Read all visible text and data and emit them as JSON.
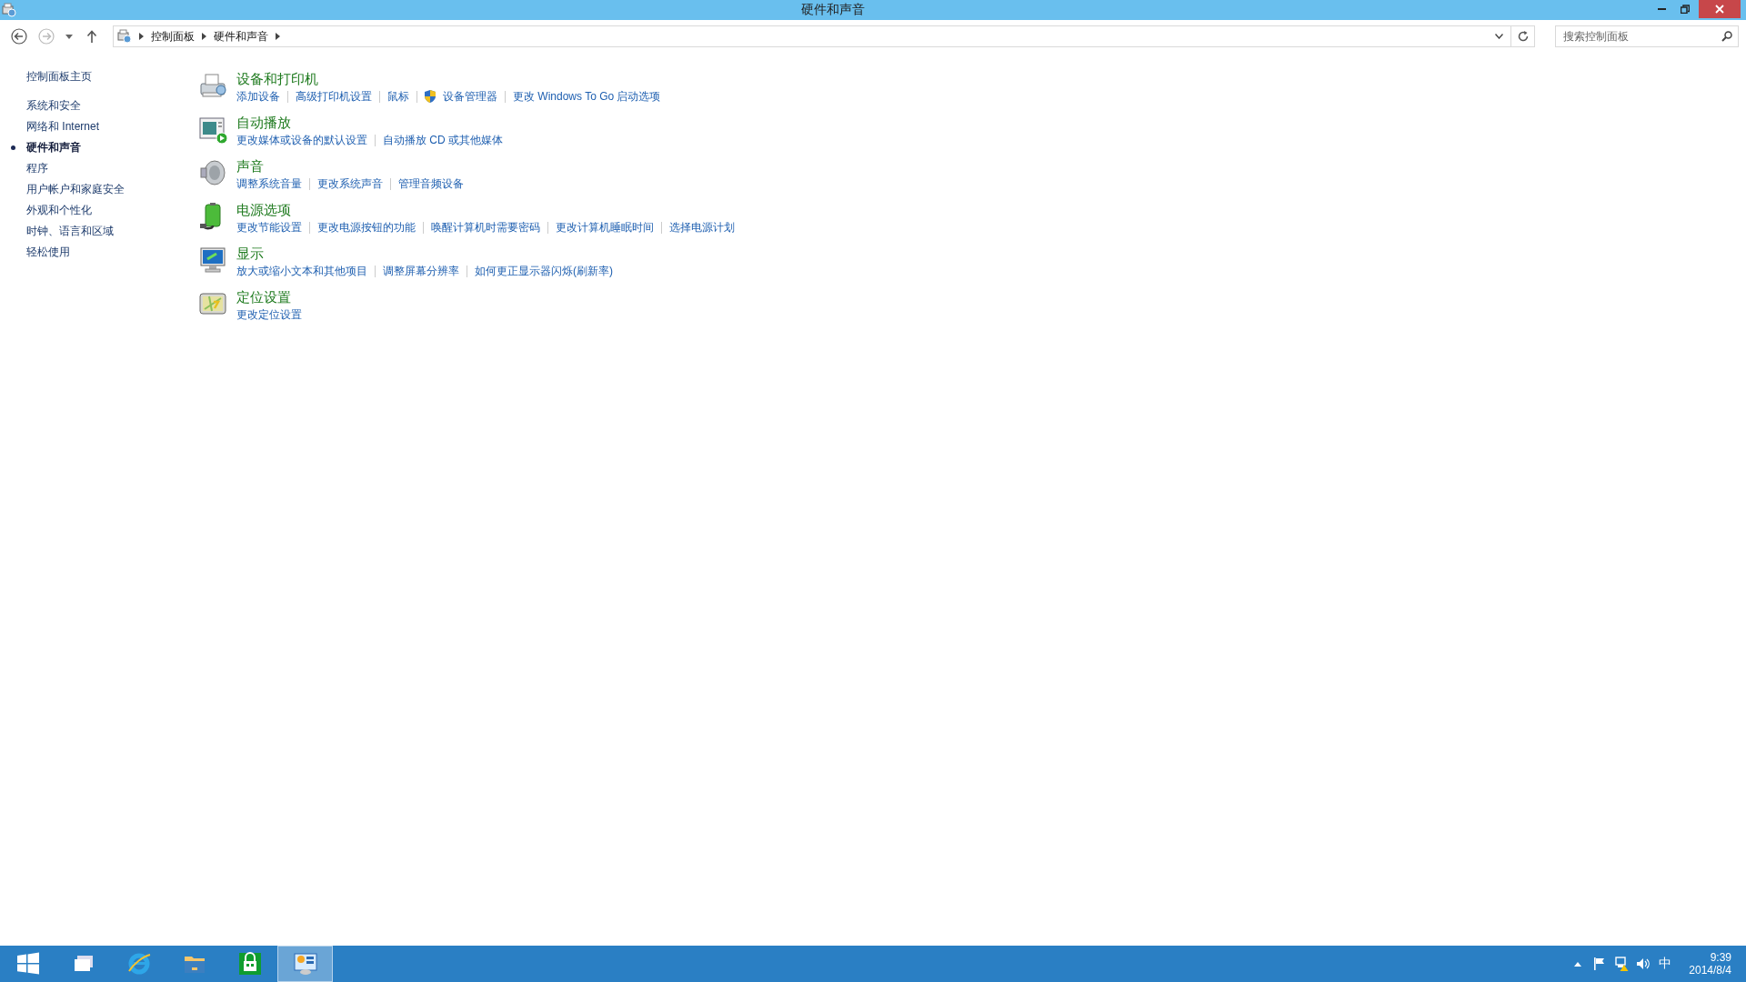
{
  "window": {
    "title": "硬件和声音"
  },
  "address_bar": {
    "breadcrumbs": [
      "控制面板",
      "硬件和声音"
    ]
  },
  "search": {
    "placeholder": "搜索控制面板"
  },
  "sidebar": {
    "home": "控制面板主页",
    "items": [
      {
        "label": "系统和安全",
        "selected": false
      },
      {
        "label": "网络和 Internet",
        "selected": false
      },
      {
        "label": "硬件和声音",
        "selected": true
      },
      {
        "label": "程序",
        "selected": false
      },
      {
        "label": "用户帐户和家庭安全",
        "selected": false
      },
      {
        "label": "外观和个性化",
        "selected": false
      },
      {
        "label": "时钟、语言和区域",
        "selected": false
      },
      {
        "label": "轻松使用",
        "selected": false
      }
    ]
  },
  "categories": [
    {
      "kind": "printer",
      "title": "设备和打印机",
      "links": [
        {
          "label": "添加设备"
        },
        {
          "label": "高级打印机设置"
        },
        {
          "label": "鼠标"
        },
        {
          "label": "设备管理器",
          "shield": true
        },
        {
          "label": "更改 Windows To Go 启动选项"
        }
      ]
    },
    {
      "kind": "autoplay",
      "title": "自动播放",
      "links": [
        {
          "label": "更改媒体或设备的默认设置"
        },
        {
          "label": "自动播放 CD 或其他媒体"
        }
      ]
    },
    {
      "kind": "sound",
      "title": "声音",
      "links": [
        {
          "label": "调整系统音量"
        },
        {
          "label": "更改系统声音"
        },
        {
          "label": "管理音频设备"
        }
      ]
    },
    {
      "kind": "power",
      "title": "电源选项",
      "links": [
        {
          "label": "更改节能设置"
        },
        {
          "label": "更改电源按钮的功能"
        },
        {
          "label": "唤醒计算机时需要密码"
        },
        {
          "label": "更改计算机睡眠时间"
        },
        {
          "label": "选择电源计划"
        }
      ]
    },
    {
      "kind": "display",
      "title": "显示",
      "links": [
        {
          "label": "放大或缩小文本和其他项目"
        },
        {
          "label": "调整屏幕分辨率"
        },
        {
          "label": "如何更正显示器闪烁(刷新率)"
        }
      ]
    },
    {
      "kind": "location",
      "title": "定位设置",
      "links": [
        {
          "label": "更改定位设置"
        }
      ]
    }
  ],
  "taskbar": {
    "apps": [
      {
        "kind": "start",
        "selected": false
      },
      {
        "kind": "taskview",
        "selected": false
      },
      {
        "kind": "ie",
        "selected": false
      },
      {
        "kind": "explorer",
        "selected": false
      },
      {
        "kind": "store",
        "selected": false
      },
      {
        "kind": "controlpanel",
        "selected": true
      }
    ],
    "ime": "中",
    "time": "9:39",
    "date": "2014/8/4"
  }
}
